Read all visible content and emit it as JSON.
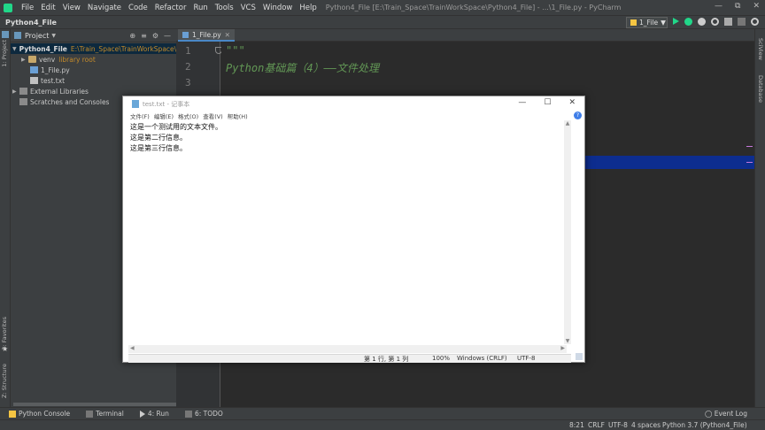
{
  "titlebar": {
    "menu": [
      "File",
      "Edit",
      "View",
      "Navigate",
      "Code",
      "Refactor",
      "Run",
      "Tools",
      "VCS",
      "Window",
      "Help"
    ],
    "window_title": "Python4_File [E:\\Train_Space\\TrainWorkSpace\\Python4_File] - ...\\1_File.py - PyCharm"
  },
  "navbar": {
    "project_name": "Python4_File",
    "run_config": "1_File"
  },
  "left_strip": {
    "project_tab": "1: Project",
    "favorites_tab": "2: Favorites",
    "structure_tab": "Z: Structure"
  },
  "right_strip": {
    "sciview_tab": "SciView",
    "database_tab": "Database"
  },
  "project_panel": {
    "title": "Project",
    "tree": [
      {
        "name": "Python4_File",
        "extra": "E:\\Train_Space\\TrainWorkSpace\\Pyt"
      },
      {
        "name": "venv",
        "extra": "library root"
      },
      {
        "name": "1_File.py",
        "extra": ""
      },
      {
        "name": "test.txt",
        "extra": ""
      },
      {
        "name": "External Libraries",
        "extra": ""
      },
      {
        "name": "Scratches and Consoles",
        "extra": ""
      }
    ]
  },
  "editor": {
    "tab_label": "1_File.py",
    "lines": [
      {
        "num": "1",
        "text": "\"\"\""
      },
      {
        "num": "2",
        "text": "    Python基础篇（4）——文件处理"
      },
      {
        "num": "3",
        "text": ""
      }
    ]
  },
  "notepad": {
    "title": "test.txt - 记事本",
    "menu": [
      "文件(F)",
      "编辑(E)",
      "格式(O)",
      "查看(V)",
      "帮助(H)"
    ],
    "content": [
      "这是一个测试用的文本文件。",
      "这是第二行信息。",
      "这是第三行信息。"
    ],
    "status": {
      "position": "第 1 行, 第 1 列",
      "zoom": "100%",
      "line_ending": "Windows (CRLF)",
      "encoding": "UTF-8"
    }
  },
  "bottom_tabs": {
    "python_console": "Python Console",
    "terminal": "Terminal",
    "run": "4: Run",
    "todo": "6: TODO",
    "event_log": "Event Log"
  },
  "statusbar": {
    "position": "8:21",
    "line_sep": "CRLF",
    "encoding": "UTF-8",
    "indent": "4 spaces",
    "interpreter": "Python 3.7 (Python4_File)"
  },
  "colors": {
    "run_green": "#21d789",
    "selection_blue": "#0d2d8f",
    "docstring_green": "#629755"
  }
}
